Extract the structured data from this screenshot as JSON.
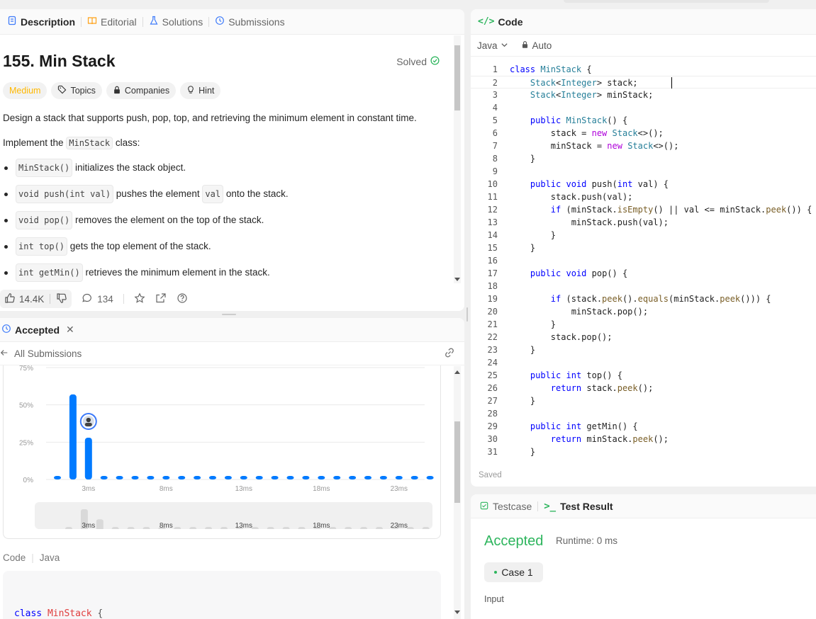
{
  "tabs": {
    "description": "Description",
    "editorial": "Editorial",
    "solutions": "Solutions",
    "submissions": "Submissions"
  },
  "problem": {
    "title": "155. Min Stack",
    "solved": "Solved",
    "difficulty": "Medium",
    "chips": [
      "Topics",
      "Companies",
      "Hint"
    ],
    "statement": "Design a stack that supports push, pop, top, and retrieving the minimum element in constant time.",
    "implement_prefix": "Implement the ",
    "implement_code": "MinStack",
    "implement_suffix": " class:",
    "methods": [
      {
        "code": "MinStack()",
        "text": " initializes the stack object."
      },
      {
        "code": "void push(int val)",
        "text_a": " pushes the element ",
        "code2": "val",
        "text_b": " onto the stack."
      },
      {
        "code": "void pop()",
        "text": " removes the element on the top of the stack."
      },
      {
        "code": "int top()",
        "text": " gets the top element of the stack."
      },
      {
        "code": "int getMin()",
        "text": " retrieves the minimum element in the stack."
      }
    ]
  },
  "actions": {
    "likes": "14.4K",
    "comments": "134"
  },
  "submission": {
    "tab_label": "Accepted",
    "all_submissions": "All Submissions",
    "code_label": "Code",
    "code_lang": "Java",
    "preview_line": "class MinStack {"
  },
  "chart_data": {
    "type": "bar",
    "ylabel_ticks": [
      "0%",
      "25%",
      "50%",
      "75%"
    ],
    "x_tick_labels": [
      "3ms",
      "8ms",
      "13ms",
      "18ms",
      "23ms"
    ],
    "ylim": [
      0,
      75
    ],
    "categories": [
      "1ms",
      "2ms",
      "3ms",
      "4ms",
      "5ms",
      "6ms",
      "7ms",
      "8ms",
      "9ms",
      "10ms",
      "11ms",
      "12ms",
      "13ms",
      "14ms",
      "15ms",
      "16ms",
      "17ms",
      "18ms",
      "19ms",
      "20ms",
      "21ms",
      "22ms",
      "23ms",
      "24ms",
      "25ms",
      "26ms",
      "27ms"
    ],
    "values": [
      1,
      57,
      28,
      0.5,
      0.5,
      0.5,
      0.5,
      0.5,
      0.5,
      0.5,
      0.5,
      0.5,
      0.5,
      0.5,
      0.5,
      0.5,
      0.5,
      0.5,
      0.5,
      0.5,
      0.5,
      0.5,
      0.5,
      0.5,
      0.5,
      0.5,
      0.5
    ],
    "user_marker_category": "3ms",
    "bar_color": "#007aff"
  },
  "code_panel": {
    "title": "Code",
    "language": "Java",
    "mode": "Auto",
    "status": "Saved",
    "lines": [
      "class MinStack {",
      "    Stack<Integer> stack;",
      "    Stack<Integer> minStack;",
      "",
      "    public MinStack() {",
      "        stack = new Stack<>();",
      "        minStack = new Stack<>();",
      "    }",
      "",
      "    public void push(int val) {",
      "        stack.push(val);",
      "        if (minStack.isEmpty() || val <= minStack.peek()) {",
      "            minStack.push(val);",
      "        }",
      "    }",
      "",
      "    public void pop() {",
      "",
      "        if (stack.peek().equals(minStack.peek())) {",
      "            minStack.pop();",
      "        }",
      "        stack.pop();",
      "    }",
      "",
      "    public int top() {",
      "        return stack.peek();",
      "    }",
      "",
      "    public int getMin() {",
      "        return minStack.peek();",
      "    }"
    ]
  },
  "result_panel": {
    "testcase_tab": "Testcase",
    "result_tab": "Test Result",
    "verdict": "Accepted",
    "runtime": "Runtime: 0 ms",
    "case": "Case 1",
    "input_label": "Input"
  },
  "colors": {
    "accent_green": "#2db55d",
    "medium": "#ffb800",
    "bar_blue": "#007aff"
  }
}
